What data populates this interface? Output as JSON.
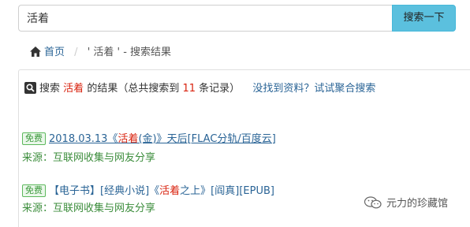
{
  "search": {
    "query": "活着",
    "button_label": "搜索一下"
  },
  "breadcrumb": {
    "home": "首页",
    "separator": "/",
    "current": "' 活着 ' - 搜索结果"
  },
  "summary": {
    "prefix": "搜索",
    "keyword": "活着",
    "middle": "的结果（总共搜索到",
    "count": "11",
    "suffix": "条记录）",
    "aggregate_link": "没找到资料？试试聚合搜索"
  },
  "results": [
    {
      "badge": "免费",
      "title_before": "2018.03.13《",
      "title_highlight": "活着",
      "title_after": "(金)》天后[FLAC分轨/百度云]",
      "source_label": "来源：互联网收集与网友分享"
    },
    {
      "badge": "免费",
      "title_before": "【电子书】[经典小说]《",
      "title_highlight": "活着",
      "title_after": "之上》[阎真][EPUB]",
      "source_label": "来源：互联网收集与网友分享"
    }
  ],
  "watermark": {
    "text": "元力的珍藏馆",
    "icon": "wechat-icon"
  },
  "colors": {
    "button_bg": "#5bc0de",
    "link": "#2a6496",
    "highlight": "#d9230f",
    "source": "#3c8d3c",
    "badge": "#5cb85c"
  }
}
